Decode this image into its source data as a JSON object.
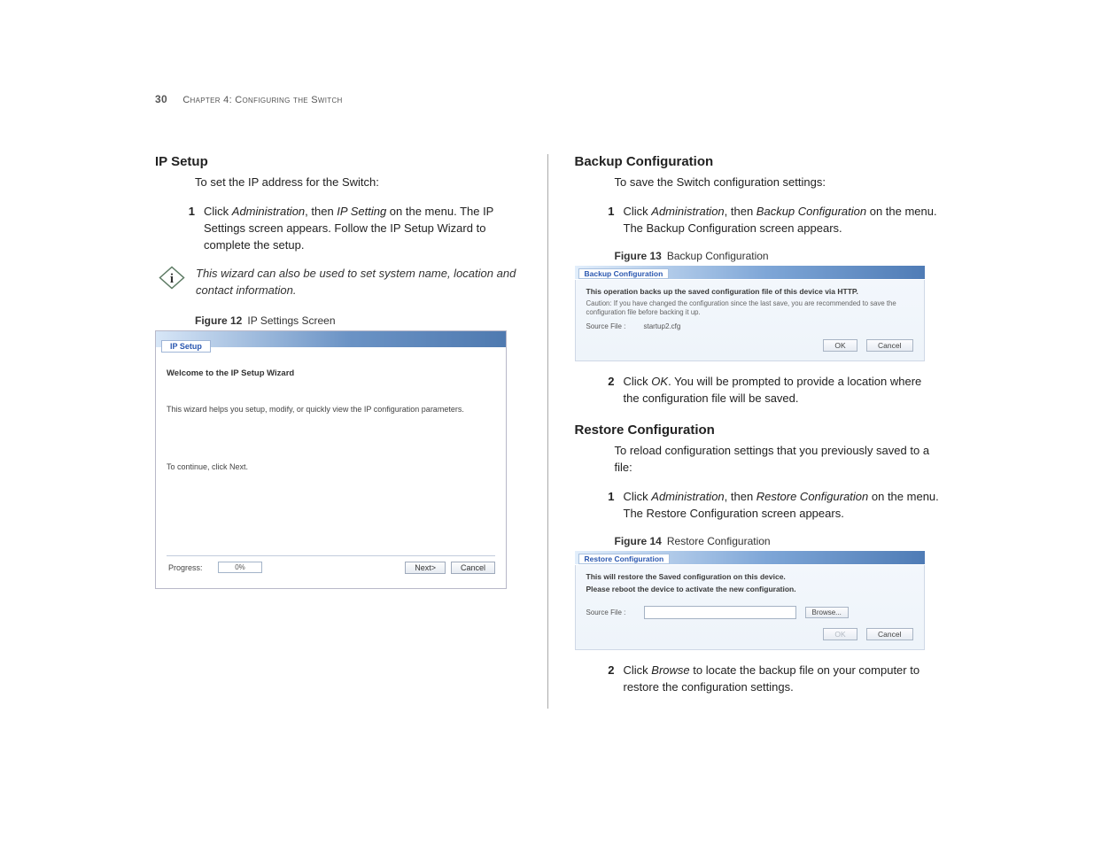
{
  "header": {
    "page_number": "30",
    "chapter_line": "Chapter 4: Configuring the Switch"
  },
  "left": {
    "title": "IP Setup",
    "intro": "To set the IP address for the Switch:",
    "step1_prefix": "Click ",
    "step1_em1": "Administration",
    "step1_mid": ", then ",
    "step1_em2": "IP Setting",
    "step1_suffix": " on the menu. The IP Settings screen appears. Follow the IP Setup Wizard to complete the setup.",
    "tip_text": "This wizard can also be used to set system name, location and contact information.",
    "fig12_label": "Figure 12",
    "fig12_title": "IP Settings Screen",
    "wizard": {
      "tab": "IP Setup",
      "welcome": "Welcome to the IP Setup Wizard",
      "desc": "This wizard helps you setup, modify, or quickly view the IP configuration parameters.",
      "cont": "To continue, click Next.",
      "progress_label": "Progress:",
      "progress_value": "0%",
      "next_btn": "Next>",
      "cancel_btn": "Cancel"
    }
  },
  "right": {
    "backup_title": "Backup Configuration",
    "backup_intro": "To save the Switch configuration settings:",
    "backup_step1_prefix": "Click ",
    "backup_step1_em1": "Administration",
    "backup_step1_mid": ", then ",
    "backup_step1_em2": "Backup Configuration",
    "backup_step1_suffix": " on the menu. The Backup Configuration screen appears.",
    "fig13_label": "Figure 13",
    "fig13_title": "Backup Configuration",
    "backup_panel": {
      "tab": "Backup Configuration",
      "desc": "This operation backs up the saved configuration file of this device via HTTP.",
      "caution": "Caution: If you have changed the configuration since the last save, you are recommended to save the configuration file before backing it up.",
      "src_label": "Source File :",
      "src_value": "startup2.cfg",
      "ok": "OK",
      "cancel": "Cancel"
    },
    "backup_step2_prefix": "Click ",
    "backup_step2_em": "OK",
    "backup_step2_suffix": ". You will be prompted to provide a location where the configuration file will be saved.",
    "restore_title": "Restore Configuration",
    "restore_intro": "To reload configuration settings that you previously saved to a file:",
    "restore_step1_prefix": "Click ",
    "restore_step1_em1": "Administration",
    "restore_step1_mid": ", then ",
    "restore_step1_em2": "Restore Configuration",
    "restore_step1_suffix": " on the menu. The Restore Configuration screen appears.",
    "fig14_label": "Figure 14",
    "fig14_title": "Restore Configuration",
    "restore_panel": {
      "tab": "Restore Configuration",
      "line1": "This will restore the Saved configuration on this device.",
      "line2": "Please reboot the device to activate the new configuration.",
      "src_label": "Source File :",
      "browse": "Browse...",
      "ok": "OK",
      "cancel": "Cancel"
    },
    "restore_step2_prefix": "Click ",
    "restore_step2_em": "Browse",
    "restore_step2_suffix": " to locate the backup file on your computer to restore the configuration settings."
  }
}
